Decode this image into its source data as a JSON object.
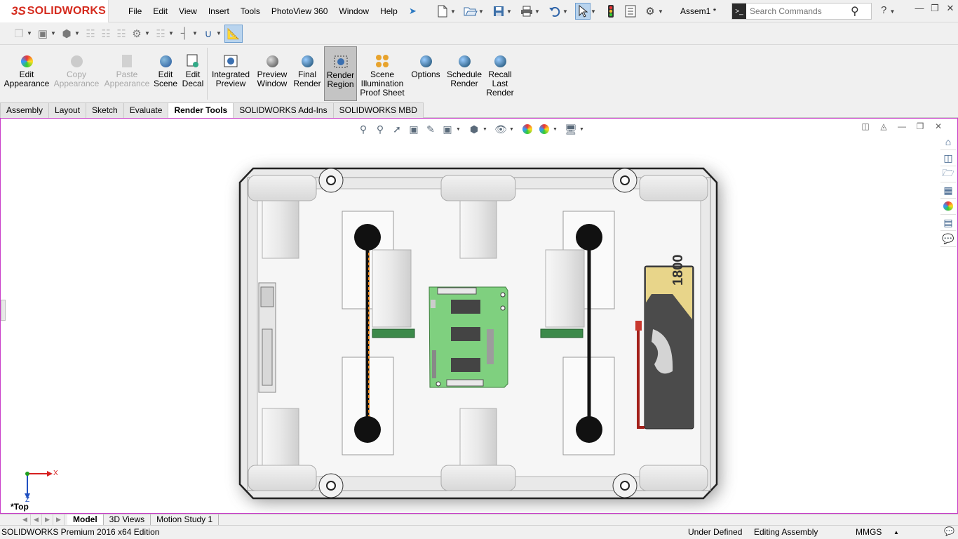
{
  "app": {
    "brand": "SOLIDWORKS",
    "document_title": "Assem1 *",
    "edition": "SOLIDWORKS Premium 2016 x64 Edition"
  },
  "menu": [
    "File",
    "Edit",
    "View",
    "Insert",
    "Tools",
    "PhotoView 360",
    "Window",
    "Help"
  ],
  "search": {
    "placeholder": "Search Commands"
  },
  "quick_access_icons": [
    "new-document-icon",
    "open-icon",
    "save-icon",
    "print-icon",
    "undo-icon",
    "select-pointer-icon",
    "traffic-light-icon",
    "file-properties-icon",
    "options-gear-icon"
  ],
  "ribbon": {
    "buttons": [
      {
        "id": "edit-appearance",
        "label": "Edit\nAppearance",
        "enabled": true,
        "active": false,
        "icon": "appearance-ball-icon"
      },
      {
        "id": "copy-appearance",
        "label": "Copy\nAppearance",
        "enabled": false,
        "active": false,
        "icon": "copy-appearance-icon"
      },
      {
        "id": "paste-appearance",
        "label": "Paste\nAppearance",
        "enabled": false,
        "active": false,
        "icon": "paste-appearance-icon"
      },
      {
        "id": "edit-scene",
        "label": "Edit\nScene",
        "enabled": true,
        "active": false,
        "icon": "scene-icon"
      },
      {
        "id": "edit-decal",
        "label": "Edit\nDecal",
        "enabled": true,
        "active": false,
        "icon": "decal-icon"
      },
      {
        "id": "integrated-preview",
        "label": "Integrated\nPreview",
        "enabled": true,
        "active": false,
        "icon": "integrated-preview-icon"
      },
      {
        "id": "preview-window",
        "label": "Preview\nWindow",
        "enabled": true,
        "active": false,
        "icon": "preview-window-icon"
      },
      {
        "id": "final-render",
        "label": "Final\nRender",
        "enabled": true,
        "active": false,
        "icon": "final-render-icon"
      },
      {
        "id": "render-region",
        "label": "Render\nRegion",
        "enabled": true,
        "active": true,
        "icon": "render-region-icon"
      },
      {
        "id": "scene-illumination",
        "label": "Scene\nIllumination\nProof Sheet",
        "enabled": true,
        "active": false,
        "icon": "illumination-proof-sheet-icon"
      },
      {
        "id": "options",
        "label": "Options",
        "enabled": true,
        "active": false,
        "icon": "render-options-icon"
      },
      {
        "id": "schedule-render",
        "label": "Schedule\nRender",
        "enabled": true,
        "active": false,
        "icon": "schedule-render-icon"
      },
      {
        "id": "recall-last-render",
        "label": "Recall\nLast\nRender",
        "enabled": true,
        "active": false,
        "icon": "recall-render-icon"
      }
    ]
  },
  "tabs": [
    {
      "label": "Assembly",
      "active": false
    },
    {
      "label": "Layout",
      "active": false
    },
    {
      "label": "Sketch",
      "active": false
    },
    {
      "label": "Evaluate",
      "active": false
    },
    {
      "label": "Render Tools",
      "active": true
    },
    {
      "label": "SOLIDWORKS Add-Ins",
      "active": false
    },
    {
      "label": "SOLIDWORKS MBD",
      "active": false
    }
  ],
  "viewport": {
    "view_name": "*Top",
    "triad": {
      "x_label": "X",
      "z_label": "Z"
    },
    "battery_label": "1800"
  },
  "bottom_tabs": [
    {
      "label": "Model",
      "active": true
    },
    {
      "label": "3D Views",
      "active": false
    },
    {
      "label": "Motion Study 1",
      "active": false
    }
  ],
  "status": {
    "definition": "Under Defined",
    "mode": "Editing Assembly",
    "units": "MMGS"
  },
  "colors": {
    "brand_red": "#d52b1e",
    "viewport_border": "#c83cc8",
    "pcb_green": "#7fd07f",
    "active_button": "#c4c4c4"
  }
}
